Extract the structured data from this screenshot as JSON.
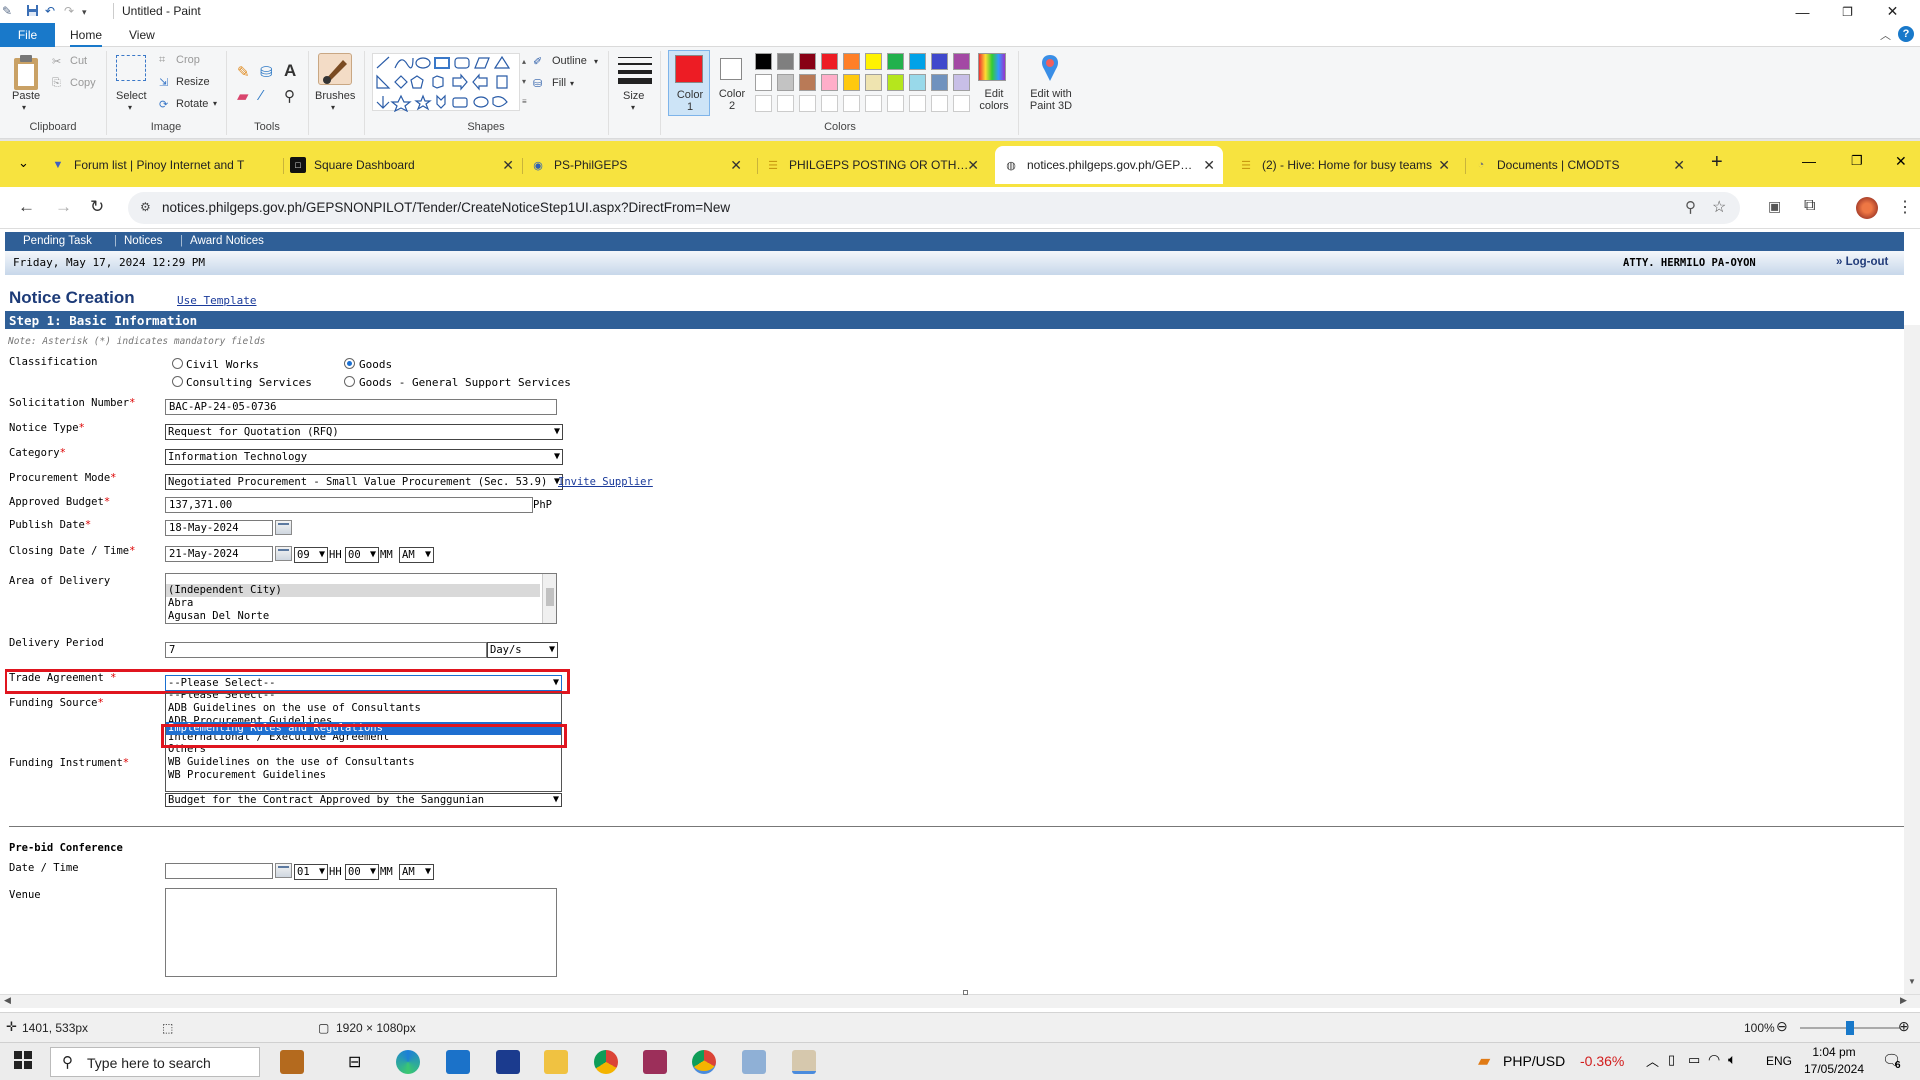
{
  "paint": {
    "title": "Untitled - Paint",
    "tabs": {
      "file": "File",
      "home": "Home",
      "view": "View"
    },
    "ribbon": {
      "paste": "Paste",
      "cut": "Cut",
      "copy": "Copy",
      "select": "Select",
      "crop": "Crop",
      "resize": "Resize",
      "rotate": "Rotate",
      "brushes": "Brushes",
      "outline": "Outline",
      "fill": "Fill",
      "size": "Size",
      "color1": "Color 1",
      "color2": "Color 2",
      "edit_colors": "Edit colors",
      "edit_with_paint3d": "Edit with Paint 3D",
      "groups": {
        "clipboard": "Clipboard",
        "image": "Image",
        "tools": "Tools",
        "shapes": "Shapes",
        "colors": "Colors"
      }
    },
    "palette_row1": [
      "#000000",
      "#7f7f7f",
      "#880015",
      "#ed1c24",
      "#ff7f27",
      "#fff200",
      "#22b14c",
      "#00a2e8",
      "#3f48cc",
      "#a349a4"
    ],
    "palette_row2": [
      "#ffffff",
      "#c3c3c3",
      "#b97a57",
      "#ffaec9",
      "#ffc90e",
      "#efe4b0",
      "#b5e61d",
      "#99d9ea",
      "#7092be",
      "#c8bfe7"
    ],
    "color1_hex": "#ed1c24",
    "color2_hex": "#ffffff",
    "status": {
      "cursor": "1401, 533px",
      "canvas_size": "1920 × 1080px",
      "zoom": "100%",
      "zoom_fraction": 0.5
    }
  },
  "browser": {
    "tabs": [
      {
        "title": "Forum list | Pinoy Internet and T",
        "icon": "forum-icon",
        "active": false
      },
      {
        "title": "Square Dashboard",
        "icon": "square-icon",
        "active": false
      },
      {
        "title": "PS-PhilGEPS",
        "icon": "philgeps-icon",
        "active": false
      },
      {
        "title": "PHILGEPS POSTING OR OTHER",
        "icon": "doc-icon",
        "active": false
      },
      {
        "title": "notices.philgeps.gov.ph/GEPSN",
        "icon": "globe-icon",
        "active": true
      },
      {
        "title": "(2) - Hive: Home for busy teams",
        "icon": "hive-icon",
        "active": false
      },
      {
        "title": "Documents | CMODTS",
        "icon": "docs-icon",
        "active": false
      }
    ],
    "url": "notices.philgeps.gov.ph/GEPSNONPILOT/Tender/CreateNoticeStep1UI.aspx?DirectFrom=New"
  },
  "page": {
    "nav": [
      "Pending Task",
      "Notices",
      "Award Notices"
    ],
    "date": "Friday, May 17, 2024 12:29 PM",
    "user": "ATTY. HERMILO PA-OYON",
    "logout": "» Log-out",
    "title": "Notice Creation",
    "use_template": "Use Template",
    "step": "Step 1: Basic Information",
    "note": "Note: Asterisk (*) indicates mandatory fields",
    "classification": {
      "label": "Classification",
      "options": [
        "Civil Works",
        "Goods",
        "Consulting Services",
        "Goods - General Support Services"
      ],
      "selected": "Goods"
    },
    "solicitation": {
      "label": "Solicitation Number",
      "value": "BAC-AP-24-05-0736"
    },
    "notice_type": {
      "label": "Notice Type",
      "value": "Request for Quotation (RFQ)"
    },
    "category": {
      "label": "Category",
      "value": "Information Technology"
    },
    "procurement_mode": {
      "label": "Procurement Mode",
      "value": "Negotiated Procurement - Small Value Procurement (Sec. 53.9)",
      "link": "Invite Supplier"
    },
    "budget": {
      "label": "Approved Budget",
      "value": "137,371.00",
      "unit": "PhP"
    },
    "publish": {
      "label": "Publish Date",
      "value": "18-May-2024"
    },
    "closing": {
      "label": "Closing Date / Time",
      "value": "21-May-2024",
      "hh": "09",
      "mm": "00",
      "ampm": "AM",
      "hh_label": "HH",
      "mm_label": "MM"
    },
    "area": {
      "label": "Area of Delivery",
      "items": [
        "(Independent City)",
        "Abra",
        "Agusan Del Norte"
      ]
    },
    "delivery": {
      "label": "Delivery Period",
      "value": "7",
      "unit": "Day/s"
    },
    "trade": {
      "label": "Trade Agreement",
      "value": "--Please Select--",
      "options": [
        "--Please Select--",
        "ADB Guidelines on the use of Consultants",
        "ADB Procurement Guidelines",
        "Implementing Rules and Regulations",
        "International / Executive Agreement",
        "Others",
        "WB Guidelines on the use of Consultants",
        "WB Procurement Guidelines"
      ],
      "highlighted": "Implementing Rules and Regulations"
    },
    "funding_source": {
      "label": "Funding Source"
    },
    "funding_instrument": {
      "label": "Funding Instrument",
      "value": "Budget for the Contract Approved by the Sanggunian"
    },
    "prebid": {
      "heading": "Pre-bid Conference",
      "datetime_label": "Date / Time",
      "hh": "01",
      "mm": "00",
      "ampm": "AM",
      "venue_label": "Venue"
    }
  },
  "taskbar": {
    "search_placeholder": "Type here to search",
    "currency": "PHP/USD",
    "currency_change": "-0.36%",
    "lang": "ENG",
    "time": "1:04 pm",
    "date": "17/05/2024",
    "notifications": "6"
  }
}
